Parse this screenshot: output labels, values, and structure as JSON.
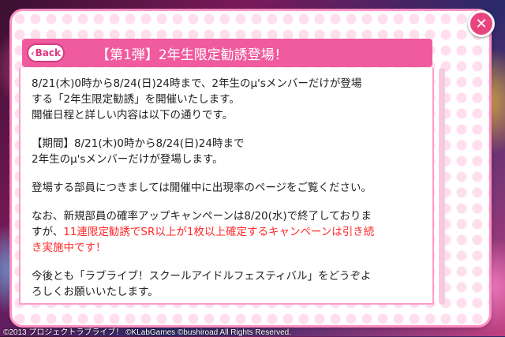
{
  "header": {
    "back_label": "Back",
    "title": "【第1弾】2年生限定勧誘登場！"
  },
  "body": {
    "p1_line1": "8/21(木)0時から8/24(日)24時まで、2年生のμ'sメンバーだけが登場",
    "p1_line2": "する「2年生限定勧誘」を開催いたします。",
    "p1_line3": "開催日程と詳しい内容は以下の通りです。",
    "p2_line1": "【期間】8/21(木)0時から8/24(日)24時まで",
    "p2_line2": "2年生のμ'sメンバーだけが登場します。",
    "p3_line1": "登場する部員につきましては開催中に出現率のページをご覧ください。",
    "p4_line1": "なお、新規部員の確率アップキャンペーンは8/20(水)で終了しておりま",
    "p4_line2_black": "すが、",
    "p4_line2_red": "11連限定勧誘でSR以上が1枚以上確定するキャンペーンは引き続",
    "p4_line3_red": "き実施中です！",
    "p5_line1": "今後とも「ラブライブ！スクールアイドルフェスティバル」をどうぞよ",
    "p5_line2": "ろしくお願いいたします。"
  },
  "footer": {
    "copyright": "©2013 プロジェクトラブライブ！ ©KLabGames ©bushiroad All Rights Reserved."
  },
  "colors": {
    "accent": "#f05a9e",
    "highlight_text": "#ff2a2a"
  }
}
